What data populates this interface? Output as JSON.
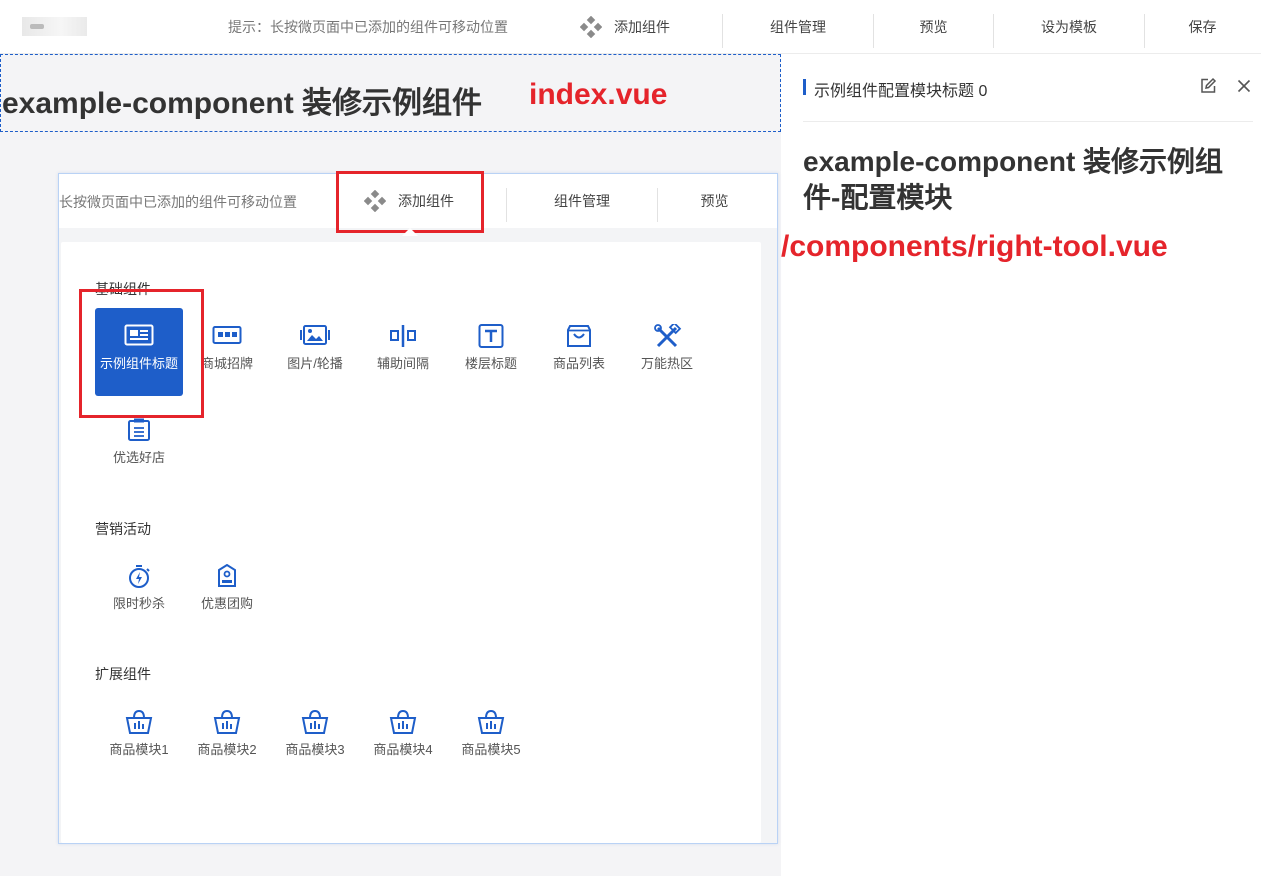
{
  "topbar": {
    "tip": "提示：长按微页面中已添加的组件可移动位置",
    "add_component": "添加组件",
    "component_manage": "组件管理",
    "preview": "预览",
    "set_template": "设为模板",
    "save": "保存"
  },
  "index_block": {
    "title": "example-component 装修示例组件",
    "file_label": "index.vue"
  },
  "right_panel": {
    "title": "示例组件配置模块标题 0",
    "config_title": "example-component 装修示例组件-配置模块",
    "path_label": "/components/right-tool.vue"
  },
  "embed": {
    "tip": "长按微页面中已添加的组件可移动位置",
    "add_component": "添加组件",
    "component_manage": "组件管理",
    "preview": "预览",
    "sections": {
      "basic": {
        "title": "基础组件",
        "items": [
          {
            "label": "示例组件标题",
            "icon": "layout-icon"
          },
          {
            "label": "商城招牌",
            "icon": "shop-sign-icon"
          },
          {
            "label": "图片/轮播",
            "icon": "image-carousel-icon"
          },
          {
            "label": "辅助间隔",
            "icon": "spacer-icon"
          },
          {
            "label": "楼层标题",
            "icon": "text-title-icon"
          },
          {
            "label": "商品列表",
            "icon": "shopping-bag-icon"
          },
          {
            "label": "万能热区",
            "icon": "tools-icon"
          },
          {
            "label": "优选好店",
            "icon": "store-icon"
          }
        ]
      },
      "marketing": {
        "title": "营销活动",
        "items": [
          {
            "label": "限时秒杀",
            "icon": "stopwatch-icon"
          },
          {
            "label": "优惠团购",
            "icon": "group-buy-icon"
          }
        ]
      },
      "extension": {
        "title": "扩展组件",
        "items": [
          {
            "label": "商品模块1",
            "icon": "basket-icon"
          },
          {
            "label": "商品模块2",
            "icon": "basket-icon"
          },
          {
            "label": "商品模块3",
            "icon": "basket-icon"
          },
          {
            "label": "商品模块4",
            "icon": "basket-icon"
          },
          {
            "label": "商品模块5",
            "icon": "basket-icon"
          }
        ]
      }
    }
  },
  "colors": {
    "accent": "#1e5ec9",
    "annotation_red": "#e5242b",
    "background": "#f4f4f6"
  }
}
